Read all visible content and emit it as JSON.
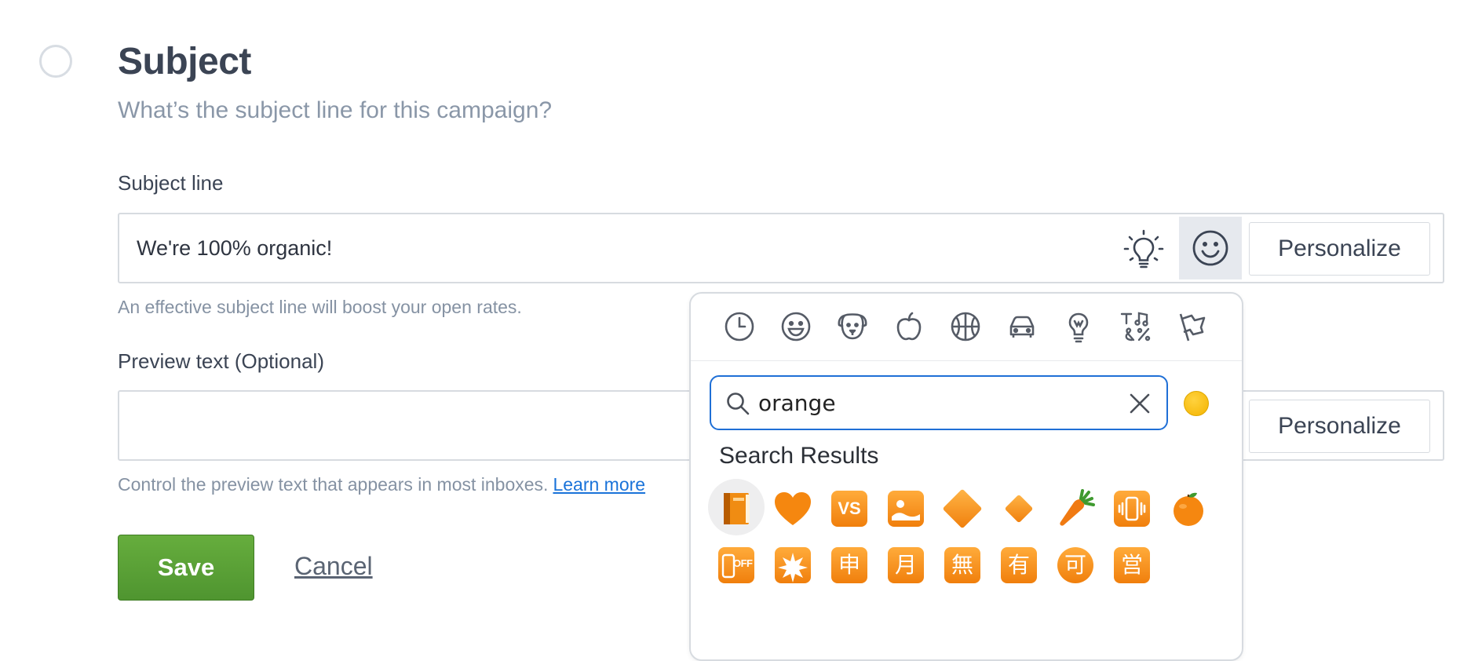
{
  "step": {
    "title": "Subject",
    "subtitle": "What’s the subject line for this campaign?"
  },
  "subject_field": {
    "label": "Subject line",
    "value": "We're 100% organic!",
    "help": "An effective subject line will boost your open rates.",
    "personalize_label": "Personalize",
    "icons": [
      "lightbulb-icon",
      "smiley-icon"
    ]
  },
  "preview_field": {
    "label": "Preview text (Optional)",
    "value": "",
    "help": "Control the preview text that appears in most inboxes.",
    "learn_more": "Learn more",
    "personalize_label": "Personalize"
  },
  "actions": {
    "save_label": "Save",
    "cancel_label": "Cancel"
  },
  "emoji_picker": {
    "categories": [
      "recent",
      "smileys",
      "animals",
      "food",
      "activity",
      "travel",
      "objects",
      "symbols",
      "flags"
    ],
    "search_value": "orange",
    "results_title": "Search Results",
    "results": [
      "orange-book",
      "orange-heart",
      "vs-button",
      "sunset-picture",
      "large-orange-diamond",
      "small-orange-diamond",
      "carrot",
      "vibration-mode",
      "tangerine",
      "mobile-phone-off",
      "eight-pointed-star",
      "japanese-monthly-amount",
      "japanese-month",
      "japanese-free-of-charge",
      "japanese-not-free-of-charge",
      "japanese-acceptable",
      "japanese-open-for-business"
    ],
    "result_glyphs": {
      "vs": "VS",
      "off": "OFF",
      "shen": "申",
      "yue": "月",
      "wu": "無",
      "you": "有",
      "ke": "可",
      "ying": "営"
    },
    "skin_tone_color": "#f4b400",
    "accent_color": "#1f6fd6"
  }
}
